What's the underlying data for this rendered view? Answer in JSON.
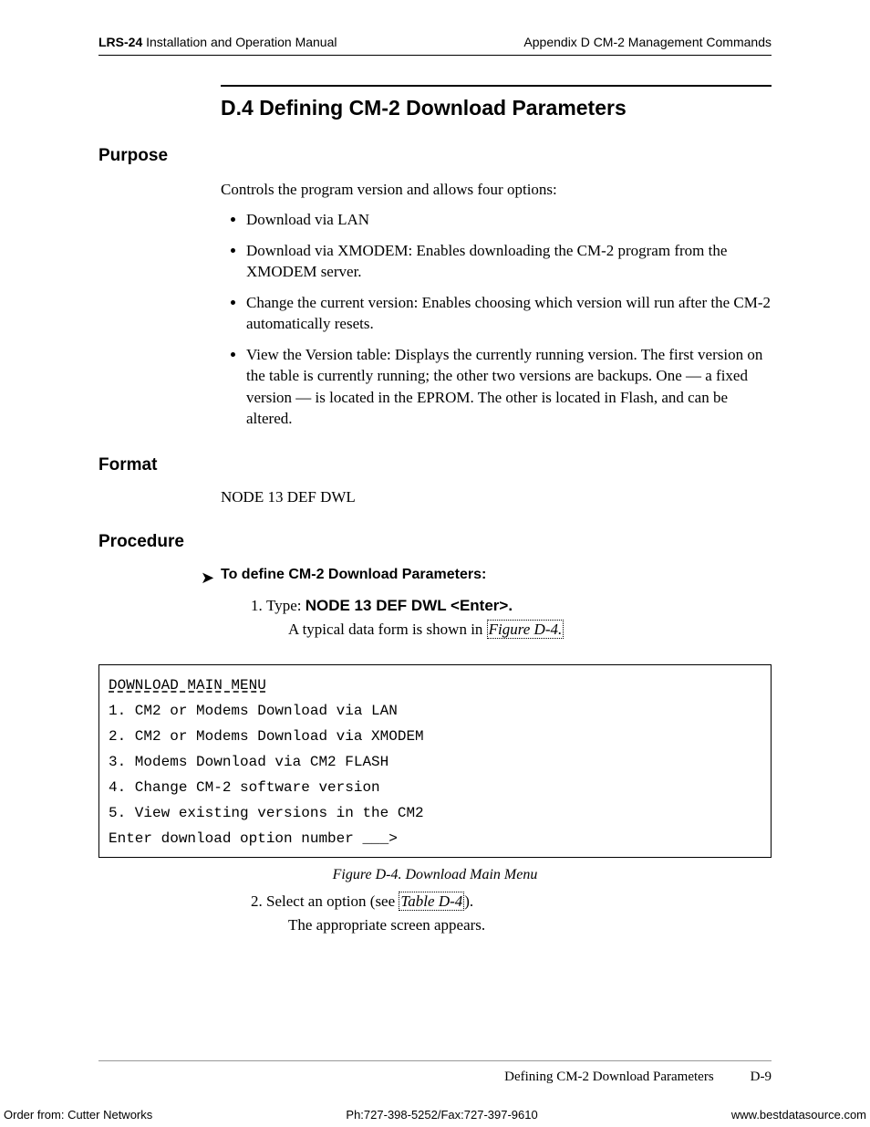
{
  "header": {
    "doc_code": "LRS-24",
    "doc_title": " Installation and Operation Manual",
    "right": "Appendix D  CM-2 Management Commands"
  },
  "section": {
    "number": "D.4",
    "title": "Defining CM-2 Download Parameters"
  },
  "purpose": {
    "heading": "Purpose",
    "intro": "Controls the program version and allows four options:",
    "bullets": [
      "Download via LAN",
      "Download via XMODEM: Enables downloading the CM-2 program from the XMODEM server.",
      "Change the current version: Enables choosing which version will run after the CM-2 automatically resets.",
      "View the Version table: Displays the currently running version. The first version on the table is currently running; the other two versions are backups. One — a fixed version — is located in the EPROM. The other is located in Flash, and can be altered."
    ]
  },
  "format": {
    "heading": "Format",
    "line": "NODE 13 DEF DWL"
  },
  "procedure": {
    "heading": "Procedure",
    "lead": "To define CM-2 Download Parameters:",
    "step1_prefix": "Type:  ",
    "step1_cmd": "NODE 13 DEF DWL <Enter>.",
    "step1_sub_a": "A typical data form is shown in ",
    "step1_figref": "Figure D-4.",
    "step2_a": "Select an option (see ",
    "step2_tabref": "Table D-4",
    "step2_b": ").",
    "step2_sub": "The appropriate screen appears."
  },
  "terminal": {
    "title": "DOWNLOAD MAIN MENU",
    "lines": [
      "1. CM2 or Modems Download via LAN",
      "2. CM2 or Modems Download via XMODEM",
      "3. Modems Download via CM2 FLASH",
      "4. Change CM-2 software version",
      "5. View existing versions in the CM2",
      "Enter download option number ___>"
    ]
  },
  "figure_caption": "Figure D-4.  Download Main Menu",
  "footer": {
    "running": "Defining CM-2 Download Parameters",
    "page": "D-9",
    "order": "Order from: Cutter Networks",
    "phone": "Ph:727-398-5252/Fax:727-397-9610",
    "site": "www.bestdatasource.com"
  }
}
